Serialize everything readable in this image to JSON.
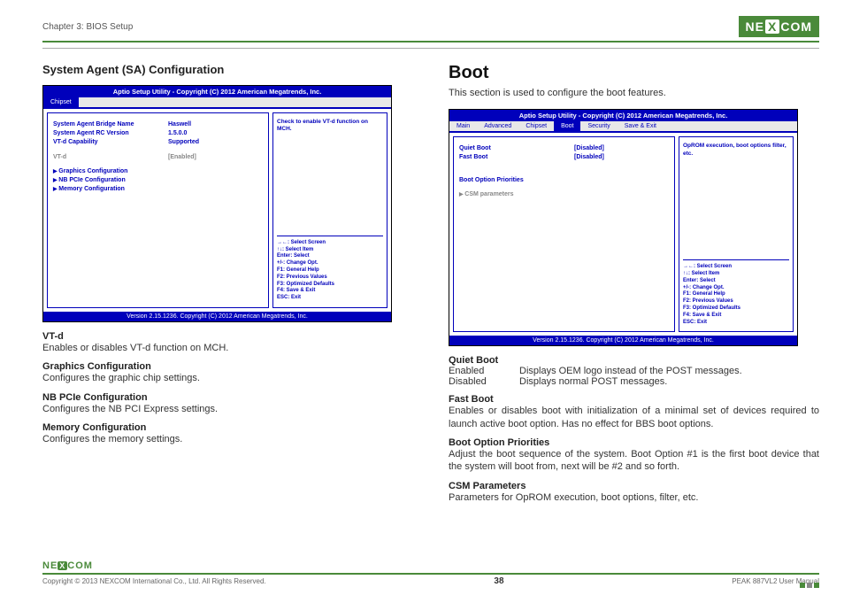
{
  "header": {
    "chapter": "Chapter 3: BIOS Setup",
    "brand": "NEXCOM"
  },
  "left": {
    "title": "System Agent (SA) Configuration",
    "bios": {
      "top": "Aptio Setup Utility - Copyright (C) 2012 American Megatrends, Inc.",
      "tabs": [
        "Chipset"
      ],
      "active_tab": "Chipset",
      "rows": [
        {
          "k": "System Agent Bridge Name",
          "v": "Haswell"
        },
        {
          "k": "System Agent RC Version",
          "v": "1.5.0.0"
        },
        {
          "k": "VT-d Capability",
          "v": "Supported"
        }
      ],
      "sel": {
        "k": "VT-d",
        "v": "[Enabled]"
      },
      "links": [
        "Graphics Configuration",
        "NB PCIe Configuration",
        "Memory Configuration"
      ],
      "help": "Check to enable VT-d function on MCH.",
      "keys": [
        "→←: Select Screen",
        "↑↓: Select Item",
        "Enter: Select",
        "+/-: Change Opt.",
        "F1: General Help",
        "F2: Previous Values",
        "F3: Optimized Defaults",
        "F4: Save & Exit",
        "ESC: Exit"
      ],
      "footer": "Version 2.15.1236. Copyright (C) 2012 American Megatrends, Inc."
    },
    "descs": [
      {
        "h": "VT-d",
        "p": "Enables or disables VT-d function on MCH."
      },
      {
        "h": "Graphics Configuration",
        "p": "Configures the graphic chip settings."
      },
      {
        "h": "NB PCIe Configuration",
        "p": "Configures the NB PCI Express settings."
      },
      {
        "h": "Memory Configuration",
        "p": "Configures the memory settings."
      }
    ]
  },
  "right": {
    "title": "Boot",
    "intro": "This section is used to configure the boot features.",
    "bios": {
      "top": "Aptio Setup Utility - Copyright (C) 2012 American Megatrends, Inc.",
      "tabs": [
        "Main",
        "Advanced",
        "Chipset",
        "Boot",
        "Security",
        "Save & Exit"
      ],
      "active_tab": "Boot",
      "rows": [
        {
          "k": "Quiet Boot",
          "v": "[Disabled]"
        },
        {
          "k": "Fast Boot",
          "v": "[Disabled]"
        }
      ],
      "section_label": "Boot Option Priorities",
      "link": "CSM parameters",
      "help": "OpROM execution, boot options filter, etc.",
      "keys": [
        "→←: Select Screen",
        "↑↓: Select Item",
        "Enter: Select",
        "+/-: Change Opt.",
        "F1: General Help",
        "F2: Previous Values",
        "F3: Optimized Defaults",
        "F4: Save & Exit",
        "ESC: Exit"
      ],
      "footer": "Version 2.15.1236. Copyright (C) 2012 American Megatrends, Inc."
    },
    "quiet_boot": {
      "h": "Quiet Boot",
      "rows": [
        {
          "k": "Enabled",
          "v": "Displays OEM logo instead of the POST messages."
        },
        {
          "k": "Disabled",
          "v": "Displays normal POST messages."
        }
      ]
    },
    "fast_boot": {
      "h": "Fast Boot",
      "p": "Enables or disables boot with initialization of a minimal  set of devices required to launch active boot option. Has no effect for BBS boot options."
    },
    "boot_pri": {
      "h": "Boot Option Priorities",
      "p": "Adjust the boot sequence of the system. Boot Option #1 is the first boot device that the system will boot from, next will be #2 and so forth."
    },
    "csm": {
      "h": "CSM Parameters",
      "p": "Parameters for OpROM execution, boot options, filter, etc."
    }
  },
  "footer": {
    "copyright": "Copyright © 2013 NEXCOM International Co., Ltd. All Rights Reserved.",
    "page": "38",
    "manual": "PEAK 887VL2 User Manual"
  }
}
